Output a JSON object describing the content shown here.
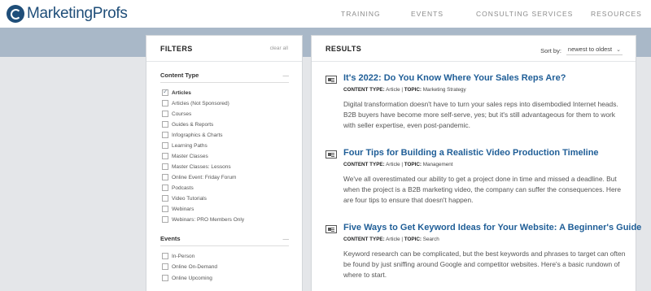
{
  "header": {
    "logo_text": "MarketingProfs",
    "nav": [
      "TRAINING",
      "EVENTS",
      "CONSULTING SERVICES",
      "RESOURCES"
    ]
  },
  "filters": {
    "title": "FILTERS",
    "clear_all": "clear all",
    "content_type": {
      "heading": "Content Type",
      "options": [
        {
          "label": "Articles",
          "checked": true
        },
        {
          "label": "Articles (Not Sponsored)",
          "checked": false
        },
        {
          "label": "Courses",
          "checked": false
        },
        {
          "label": "Guides & Reports",
          "checked": false
        },
        {
          "label": "Infographics & Charts",
          "checked": false
        },
        {
          "label": "Learning Paths",
          "checked": false
        },
        {
          "label": "Master Classes",
          "checked": false
        },
        {
          "label": "Master Classes: Lessons",
          "checked": false
        },
        {
          "label": "Online Event: Friday Forum",
          "checked": false
        },
        {
          "label": "Podcasts",
          "checked": false
        },
        {
          "label": "Video Tutorials",
          "checked": false
        },
        {
          "label": "Webinars",
          "checked": false
        },
        {
          "label": "Webinars: PRO Members Only",
          "checked": false
        }
      ]
    },
    "events": {
      "heading": "Events",
      "options": [
        {
          "label": "In-Person",
          "checked": false
        },
        {
          "label": "Online On-Demand",
          "checked": false
        },
        {
          "label": "Online Upcoming",
          "checked": false
        }
      ]
    }
  },
  "results": {
    "title": "RESULTS",
    "sort_label": "Sort by:",
    "sort_value": "newest to oldest",
    "meta_type_label": "CONTENT TYPE:",
    "meta_topic_label": "TOPIC:",
    "items": [
      {
        "title": "It's 2022: Do You Know Where Your Sales Reps Are?",
        "type": "Article",
        "topic": "Marketing Strategy",
        "description": "Digital transformation doesn't have to turn your sales reps into disembodied Internet heads. B2B buyers have become more self-serve, yes; but it's still advantageous for them to work with seller expertise, even post-pandemic."
      },
      {
        "title": "Four Tips for Building a Realistic Video Production Timeline",
        "type": "Article",
        "topic": "Management",
        "description": "We've all overestimated our ability to get a project done in time and missed a deadline. But when the project is a B2B marketing video, the company can suffer the consequences. Here are four tips to ensure that doesn't happen."
      },
      {
        "title": "Five Ways to Get Keyword Ideas for Your Website: A Beginner's Guide",
        "type": "Article",
        "topic": "Search",
        "description": "Keyword research can be complicated, but the best keywords and phrases to target can often be found by just sniffing around Google and competitor websites. Here's a basic rundown of where to start."
      }
    ]
  },
  "colors": {
    "brand": "#1f4e79",
    "link": "#1f5e97",
    "band": "#a9b8c8",
    "page_bg": "#e4e6e9"
  }
}
